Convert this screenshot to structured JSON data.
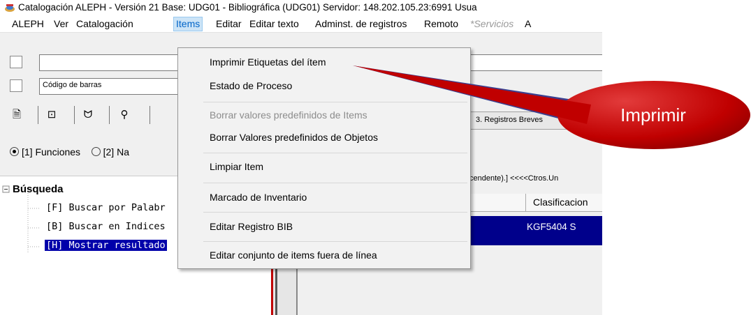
{
  "window": {
    "title": "Catalogación ALEPH - Versión 21  Base:  UDG01 - Bibliográfica (UDG01)  Servidor: 148.202.105.23:6991  Usua"
  },
  "menubar": {
    "items": [
      {
        "label": "ALEPH",
        "state": "normal"
      },
      {
        "label": "Ver",
        "state": "normal"
      },
      {
        "label": "Catalogación",
        "state": "normal"
      },
      {
        "label": "Items",
        "state": "active"
      },
      {
        "label": "Editar",
        "state": "normal"
      },
      {
        "label": "Editar texto",
        "state": "normal"
      },
      {
        "label": "Adminst. de registros",
        "state": "normal"
      },
      {
        "label": "Remoto",
        "state": "normal"
      },
      {
        "label": "*Servicios",
        "state": "disabled"
      },
      {
        "label": "A",
        "state": "normal"
      }
    ]
  },
  "toolbar": {
    "barcode_field": "Código de barras",
    "top_field": ""
  },
  "left_tabs": {
    "icons": [
      "catalog-icon",
      "item-icon",
      "acquisition-icon",
      "search-binoculars-icon"
    ],
    "glyphs": [
      "🗎",
      "⊡",
      "ᗢ",
      "⚲"
    ]
  },
  "search_mode": {
    "option1": "[1] Funciones",
    "option2": "[2] Na",
    "selected": "option1"
  },
  "tree": {
    "root": "Búsqueda",
    "items": [
      "[F] Buscar por Palabr",
      "[B] Buscar en Indices",
      "[H] Mostrar resultado"
    ]
  },
  "right_panel": {
    "tab_label": "3. Registros Breves",
    "sort_text": "cendente).]  <<<<Ctros.Un",
    "column_header": "Clasificacion",
    "selected_row_value": "KGF5404 S"
  },
  "items_menu": {
    "entries": [
      {
        "label": "Imprimir Etiquetas del ítem",
        "enabled": true
      },
      {
        "label": "Estado de Proceso",
        "enabled": true
      },
      {
        "label": "Borrar valores predefinidos de Items",
        "enabled": false
      },
      {
        "label": "Borrar Valores predefinidos de Objetos",
        "enabled": true
      },
      {
        "label": "Limpiar Item",
        "enabled": true
      },
      {
        "label": "Marcado de Inventario",
        "enabled": true
      },
      {
        "label": "Editar Registro BIB",
        "enabled": true
      },
      {
        "label": "Editar conjunto de items fuera de línea",
        "enabled": true
      }
    ]
  },
  "callout": {
    "text": "Imprimir",
    "color": "#c00000"
  },
  "colors": {
    "selection": "#0000aa",
    "menu_active_bg": "#cce4f7",
    "menu_active_border": "#99c9ef"
  }
}
